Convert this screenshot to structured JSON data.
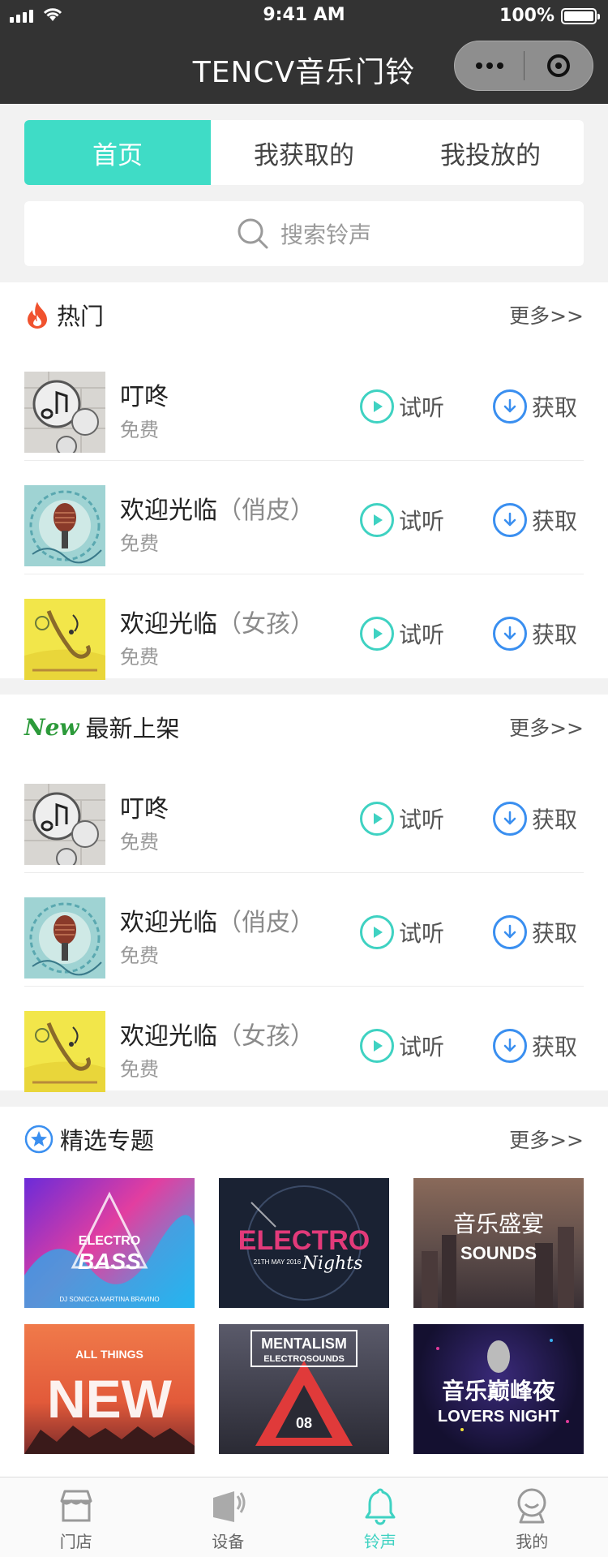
{
  "status_bar": {
    "time": "9:41 AM",
    "battery": "100%"
  },
  "nav": {
    "title": "TENCV音乐门铃"
  },
  "tabs": [
    {
      "label": "首页",
      "active": true
    },
    {
      "label": "我获取的",
      "active": false
    },
    {
      "label": "我投放的",
      "active": false
    }
  ],
  "search": {
    "placeholder": "搜索铃声"
  },
  "hot": {
    "title": "热门",
    "more": "更多>>",
    "items": [
      {
        "name": "叮咚",
        "sub": "",
        "price": "免费",
        "art": "note"
      },
      {
        "name": "欢迎光临",
        "sub": "（俏皮）",
        "price": "免费",
        "art": "mic"
      },
      {
        "name": "欢迎光临",
        "sub": "（女孩）",
        "price": "免费",
        "art": "sax"
      }
    ]
  },
  "latest": {
    "badge": "New",
    "title": "最新上架",
    "more": "更多>>",
    "items": [
      {
        "name": "叮咚",
        "sub": "",
        "price": "免费",
        "art": "note"
      },
      {
        "name": "欢迎光临",
        "sub": "（俏皮）",
        "price": "免费",
        "art": "mic"
      },
      {
        "name": "欢迎光临",
        "sub": "（女孩）",
        "price": "免费",
        "art": "sax"
      }
    ]
  },
  "actions": {
    "play": "试听",
    "get": "获取"
  },
  "topics": {
    "title": "精选专题",
    "more": "更多>>",
    "tiles": [
      {
        "line1": "ELECTRO",
        "line2": "BASS",
        "caption": "DJ SONICCA   MARTINA BRAVINO"
      },
      {
        "line1": "ELECTRO",
        "line2": "Nights",
        "caption": "21TH MAY 2016"
      },
      {
        "line1": "音乐盛宴",
        "line2": "SOUNDS",
        "caption": ""
      },
      {
        "line1": "ALL THINGS",
        "line2": "NEW",
        "caption": ""
      },
      {
        "line1": "MENTALISM",
        "line2": "ELECTROSOUNDS",
        "caption": "08"
      },
      {
        "line1": "音乐巅峰夜",
        "line2": "LOVERS NIGHT",
        "caption": ""
      }
    ]
  },
  "tabbar": [
    {
      "label": "门店",
      "icon": "store-icon",
      "active": false
    },
    {
      "label": "设备",
      "icon": "device-icon",
      "active": false
    },
    {
      "label": "铃声",
      "icon": "bell-icon",
      "active": true
    },
    {
      "label": "我的",
      "icon": "user-icon",
      "active": false
    }
  ],
  "colors": {
    "accent": "#3fdcc6",
    "play": "#3fd2c2",
    "get": "#3a8ff0",
    "navbar": "#333333"
  }
}
